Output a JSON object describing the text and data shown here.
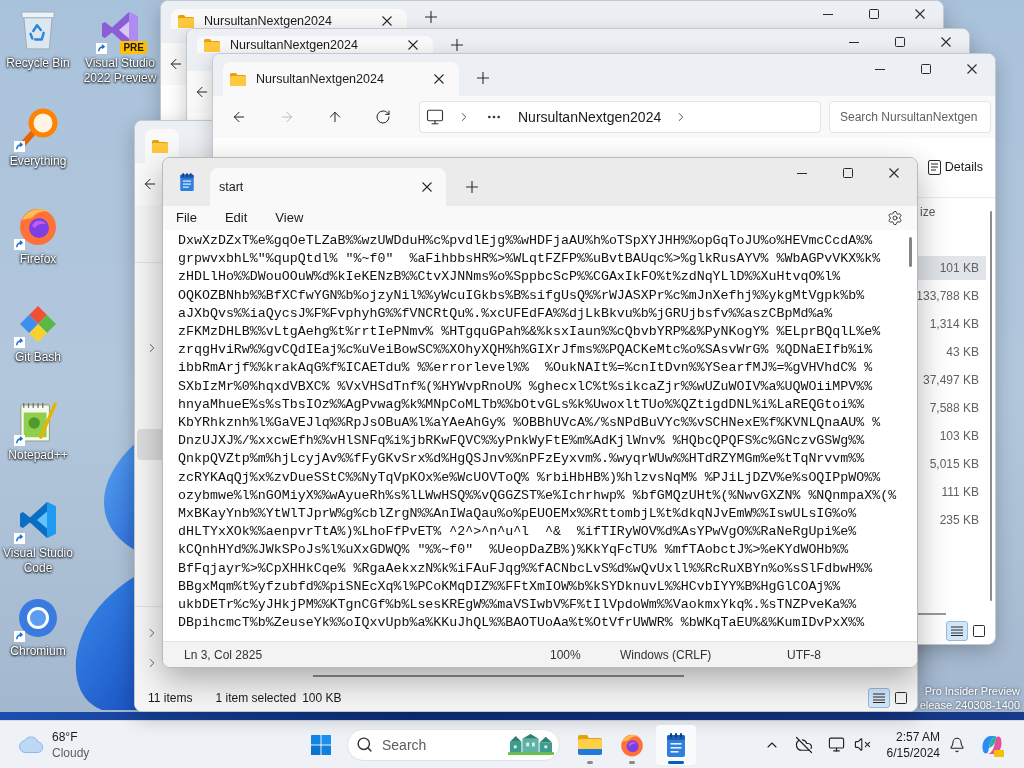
{
  "desktop": {
    "icons": [
      {
        "label": "Recycle Bin",
        "kind": "recycle-bin",
        "shortcut": false
      },
      {
        "label": "Everything",
        "kind": "everything",
        "shortcut": true
      },
      {
        "label": "Firefox",
        "kind": "firefox",
        "shortcut": true
      },
      {
        "label": "Git Bash",
        "kind": "git-bash",
        "shortcut": true
      },
      {
        "label": "Notepad++",
        "kind": "notepad-plus",
        "shortcut": true
      },
      {
        "label": "Visual Studio Code",
        "kind": "vscode",
        "shortcut": true
      },
      {
        "label": "Chromium",
        "kind": "chromium",
        "shortcut": true
      },
      {
        "label": "Visual Studio 2022 Preview",
        "kind": "visual-studio",
        "shortcut": true,
        "badge": "PRE"
      }
    ],
    "build_info": [
      "Pro Insider Preview",
      "elease 240308-1400"
    ]
  },
  "explorer_windows": [
    {
      "kind": "back",
      "tab": {
        "label": "NursultanNextgen2024",
        "selected": true
      },
      "nav": [
        {
          "kind": "back",
          "disabled": false
        }
      ]
    },
    {
      "kind": "back",
      "tab": {
        "label": "NursultanNextgen2024",
        "selected": true
      },
      "nav": [
        {
          "kind": "back",
          "disabled": false
        }
      ]
    },
    {
      "kind": "side",
      "tab": {
        "selected": true
      },
      "nav": [
        {
          "kind": "back",
          "disabled": false
        }
      ],
      "nav_pane": {
        "items": [
          {
            "kind": "group",
            "expanded": false
          },
          {
            "kind": "entry",
            "selected": true
          },
          {
            "kind": "group",
            "expanded": false
          },
          {
            "kind": "group",
            "expanded": false
          }
        ]
      },
      "status_bar": {
        "item_count": "11 items",
        "selection": "1 item selected",
        "size": "100 KB"
      },
      "views": [
        {
          "kind": "details",
          "selected": true
        },
        {
          "kind": "tiles",
          "selected": false
        }
      ]
    },
    {
      "kind": "front",
      "tab": {
        "label": "NursultanNextgen2024",
        "selected": true
      },
      "nav": [
        {
          "kind": "back",
          "disabled": false
        },
        {
          "kind": "forward",
          "disabled": true
        },
        {
          "kind": "up",
          "disabled": false
        },
        {
          "kind": "refresh",
          "disabled": false
        }
      ],
      "address": {
        "crumbs": [
          "NursultanNextgen2024"
        ]
      },
      "search": {
        "placeholder": "Search NursultanNextgen"
      },
      "toolbar": {
        "details": "Details"
      },
      "columns": [
        "ize"
      ],
      "rows": [
        {
          "size": "101 KB",
          "selected": true
        },
        {
          "size": "133,788 KB",
          "selected": false
        },
        {
          "size": "1,314 KB",
          "selected": false
        },
        {
          "size": "43 KB",
          "selected": false
        },
        {
          "size": "37,497 KB",
          "selected": false
        },
        {
          "size": "7,588 KB",
          "selected": false
        },
        {
          "size": "103 KB",
          "selected": false
        },
        {
          "size": "5,015 KB",
          "selected": false
        },
        {
          "size": "111 KB",
          "selected": false
        },
        {
          "size": "235 KB",
          "selected": false
        }
      ],
      "views": [
        {
          "kind": "details",
          "selected": true
        },
        {
          "kind": "tiles",
          "selected": false
        }
      ]
    }
  ],
  "notepad": {
    "tab": {
      "label": "start",
      "selected": true
    },
    "menu": [
      "File",
      "Edit",
      "View"
    ],
    "lines": [
      "DxwXzDZxT%e%gqOeTLZaB%%wzUWDduH%c%pvdlEjg%%wHDFjaAU%h%oTSpXYJHH%%opGqToJU%o%HEVmcCcdA%%",
      "grpwvxbhL%\"%qupQtdl% \"%~f0\"  %aFihbbsHR%>%WLqtFZFP%%uBvtBAUqc%>%glkRusAYV% %WbAGPvVKX%k%",
      "zHDLlHo%%DWouOOuW%d%kIeKENzB%%CtvXJNNms%o%SppbcScP%%CGAxIkFO%t%zdNqYLlD%%XuHtvqO%l%",
      "OQKOZBNhb%%BfXCfwYGN%b%ojzyNil%%yWcuIGkbs%B%sifgUsQ%%rWJASXPr%c%mJnXefhj%%ykgMtVgpk%b%",
      "aJXbQvs%%iaQycsJ%F%FvphyhG%%fVNCRtQu%.%xcUFEdFA%%djLkBkvu%b%jGRUjbsfv%%aszCBpMd%a%",
      "zFKMzDHLB%%vLtgAehg%t%rrtIePNmv% %HTgquGPah%&%ksxIaun%%cQbvbYRP%&%PyNKogY% %ELprBQqlL%e%",
      "zrqgHviRw%%gvCQdIEaj%c%uVeiBowSC%%XOhyXQH%h%GIXrJfms%%PQACKeMtc%o%SAsvWrG% %QDNaEIfb%i%",
      "ibbRmArjf%%krakAqG%f%ICAETdu% %%errorlevel%%  %OukNAIt%=%cnItDvn%%YSearfMJ%=%gVHVhdC% %",
      "SXbIzMr%0%hqxdVBXC% %VxVHSdTnf%(%HYWvpRnoU% %ghecxlC%t%sikcaZjr%%wUZuWOIV%a%UQWOiiMPV%%",
      "hnyaMhueE%s%sTbsIOz%%AgPvwag%k%MNpCoMLTb%%bOtvGLs%k%UwoxltTUo%%QZtigdDNL%i%LaREQGtoi%%",
      "KbYRhkznh%l%GaVEJlq%%RpJsOBuA%l%aYAeAhGy% %OBBhUVcA%/%sNPdBuVYc%%vSCHNexE%f%KVNLQnaAU% %",
      "DnzUJXJ%/%xxcwEfh%%vHlSNFq%i%jbRKwFQVC%%yPnkWyFtE%m%AdKjlWnv% %HQbcQPQFS%c%GNczvGSWg%%",
      "QnkpQVZtp%m%hjLcyjAv%%fFyGKvSrx%d%HgQSJnv%%nPFzEyxvm%.%wyqrWUw%%HTdRZYMGm%e%tTqNrvvm%%",
      "zcRYKAqQj%x%zvDueSStC%%NyTqVpKOx%e%WcUOVToQ% %rbiHbHB%)%hlzvsNqM% %PJiLjDZV%e%sOQIPpWO%%",
      "ozybmwe%l%nGOMiyX%%wAyueRh%s%lLWwHSQ%%vQGGZST%e%Ichrhwp% %bfGMQzUHt%(%NwvGXZN% %NQnmpaX%(%",
      "MxBKayYnb%%YtWlTJprW%g%cblZrgN%%AnIWaQau%o%pEUOEMx%%RttombjL%t%dkqNJvEmW%%IswULsIG%o%",
      "dHLTYxXOk%%aenpvrTtA%)%LhoFfPvET% ^2^>^n^u^l  ^&  %ifTIRyWOV%d%AsYPwVgO%%RaNeRgUpi%e%",
      "kCQnhHYd%%JWkSPoJs%l%uXxGDWQ% \"%%~f0\"  %UeopDaZB%)%KkYqFcTU% %mfTAobctJ%>%eKYdWOHb%%",
      "BfFqjayr%>%CpXHHkCqe% %RgaAekxzN%k%iFAuFJqg%%fACNbcLvS%d%wQvUxll%%RcRuXBYn%o%sSlFdbwH%%",
      "BBgxMqm%t%yfzubfd%%piSNEcXq%l%PCoKMqDIZ%%FFtXmIOW%b%kSYDknuvL%%HCvbIYY%B%HgGlCOAj%%",
      "ukbDETr%c%yJHkjPM%%KTgnCGf%b%LsesKREgW%%maVSIwbV%F%tIlVpdoWm%%VaokmxYkq%.%sTNZPveKa%%",
      "DBpihcmcT%b%ZeuseYk%%oIQxvUpb%a%KKuJhQL%%BAOTUoAa%t%OtVfrUWWR% %bWKqTaEU%&%KumIDvPxX%%"
    ],
    "status_bar": {
      "position": "Ln 3, Col 2825",
      "zoom": "100%",
      "line_ending": "Windows (CRLF)",
      "encoding": "UTF-8"
    }
  },
  "taskbar": {
    "weather": {
      "temperature": "68°F",
      "condition": "Cloudy"
    },
    "search": {
      "placeholder": "Search"
    },
    "apps": [
      {
        "kind": "file-explorer",
        "running": true,
        "active": false
      },
      {
        "kind": "firefox",
        "running": true,
        "active": false
      },
      {
        "kind": "notepad",
        "running": true,
        "active": true
      }
    ],
    "clock": {
      "time": "2:57 AM",
      "date": "6/15/2024"
    }
  }
}
